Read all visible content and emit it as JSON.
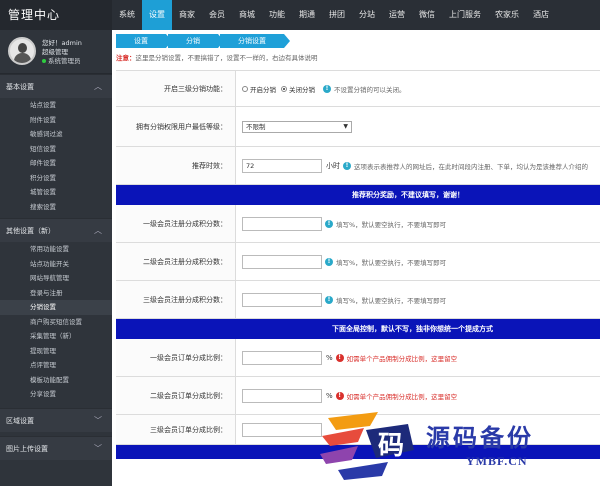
{
  "app": {
    "title": "管理中心"
  },
  "topnav": [
    "系统",
    "设置",
    "商家",
    "会员",
    "商城",
    "功能",
    "期通",
    "拼团",
    "分站",
    "运营",
    "微信",
    "上门服务",
    "农家乐",
    "酒店"
  ],
  "topnav_active": 1,
  "profile": {
    "greeting": "您好！admin",
    "role": "超级管理",
    "status": "系统管理员"
  },
  "sidebar": {
    "group1": {
      "title": "基本设置",
      "items": [
        "站点设置",
        "附件设置",
        "敏感词过滤",
        "短信设置",
        "邮件设置",
        "积分设置",
        "城管设置",
        "搜索设置"
      ]
    },
    "group2": {
      "title": "其他设置（新）",
      "items": [
        "常用功能设置",
        "站点功能开关",
        "网站导航管理",
        "登录与注册",
        "分销设置",
        "商户购买短信设置",
        "采集管理（新）",
        "提现管理",
        "点评管理",
        "模板功能配置",
        "分享设置"
      ],
      "active": 4
    },
    "group3": {
      "title": "区域设置"
    },
    "group4": {
      "title": "图片上传设置"
    }
  },
  "breadcrumb": [
    "设置",
    "分销",
    "分销设置"
  ],
  "notice": {
    "label": "注意：",
    "text": "这里是分销设置，不要搞错了，设置不一样的，右边有具体说明"
  },
  "form": {
    "enable": {
      "label": "开启三级分销功能：",
      "opt_on": "开启分销",
      "opt_off": "关闭分销",
      "hint": "不设置分销的可以关闭。"
    },
    "min_level": {
      "label": "拥有分销权限用户最低等级：",
      "value": "不限制"
    },
    "time": {
      "label": "推荐时效：",
      "value": "72",
      "unit": "小时",
      "hint": "这项表示表推荐人的网址后，在此时间段内注册、下单，均认为是该推荐人介绍的"
    },
    "band1": "推荐积分奖励，不建议填写，谢谢！",
    "reg1": {
      "label": "一级会员注册分成积分数："
    },
    "reg2": {
      "label": "二级会员注册分成积分数："
    },
    "reg3": {
      "label": "三级会员注册分成积分数："
    },
    "reg_hint": "填写%，默认要空执行，不要填写即可",
    "band2": "下面全局控制，默认不写，独非你想统一个提成方式",
    "ord1": {
      "label": "一级会员订单分成比例："
    },
    "ord2": {
      "label": "二级会员订单分成比例："
    },
    "ord3": {
      "label": "三级会员订单分成比例："
    },
    "ord_unit": "%",
    "ord_hint": "如需单个产品佣制分成比例，这里留空"
  },
  "watermark": {
    "title": "源码备份",
    "subtitle": "YMBF.CN",
    "glyph": "码"
  },
  "colors": {
    "accent": "#1fa0d8",
    "band": "#0a14b8",
    "sidebar": "#2f343b",
    "warn": "#d9302c"
  }
}
